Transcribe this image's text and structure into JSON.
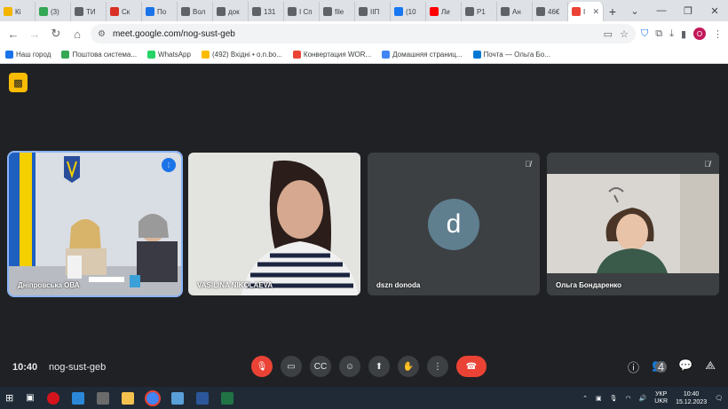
{
  "browser": {
    "tabs": [
      {
        "label": "Кі",
        "color": "#f4b400"
      },
      {
        "label": "(3)",
        "color": "#34a853"
      },
      {
        "label": "ТИ",
        "color": "#5f6368"
      },
      {
        "label": "Ск",
        "color": "#d93025"
      },
      {
        "label": "По",
        "color": "#1a73e8"
      },
      {
        "label": "Вол",
        "color": "#5f6368"
      },
      {
        "label": "док",
        "color": "#5f6368"
      },
      {
        "label": "131",
        "color": "#5f6368"
      },
      {
        "label": "І Сп",
        "color": "#5f6368"
      },
      {
        "label": "file",
        "color": "#5f6368"
      },
      {
        "label": "ІІП",
        "color": "#5f6368"
      },
      {
        "label": "(10",
        "color": "#1877f2"
      },
      {
        "label": "Ли",
        "color": "#ff0000"
      },
      {
        "label": "Р1",
        "color": "#5f6368"
      },
      {
        "label": "Ан",
        "color": "#5f6368"
      },
      {
        "label": "46€",
        "color": "#5f6368"
      },
      {
        "label": "І",
        "color": "#ea4335",
        "active": true
      }
    ],
    "new_tab": "+",
    "window_controls": [
      "⌄",
      "—",
      "❐",
      "✕"
    ],
    "url": "meet.google.com/nog-sust-geb",
    "profile_initial": "O",
    "bookmarks": [
      {
        "label": "Наш город",
        "color": "#1a73e8"
      },
      {
        "label": "Поштова система...",
        "color": "#34a853"
      },
      {
        "label": "WhatsApp",
        "color": "#25d366"
      },
      {
        "label": "(492) Вхідні • o.n.bo...",
        "color": "#fbbc04"
      },
      {
        "label": "Конвертация WOR...",
        "color": "#ea4335"
      },
      {
        "label": "Домашняя страниц...",
        "color": "#4285f4"
      },
      {
        "label": "Почта — Ольга Бо...",
        "color": "#0078d4"
      }
    ]
  },
  "meet": {
    "participants": [
      {
        "name": "Дніпровська ОВА",
        "type": "video",
        "speaking": true
      },
      {
        "name": "VASILINA NIKOLAEVA",
        "type": "video"
      },
      {
        "name": "dszn donoda",
        "type": "avatar",
        "initial": "d",
        "muted": true
      },
      {
        "name": "Ольга Бондаренко",
        "type": "video",
        "muted": true
      }
    ],
    "time": "10:40",
    "meeting_code": "nog-sust-geb",
    "people_count": "4"
  },
  "taskbar": {
    "lang_top": "УКР",
    "lang_bottom": "UKR",
    "time": "10:40",
    "date": "15.12.2023"
  }
}
